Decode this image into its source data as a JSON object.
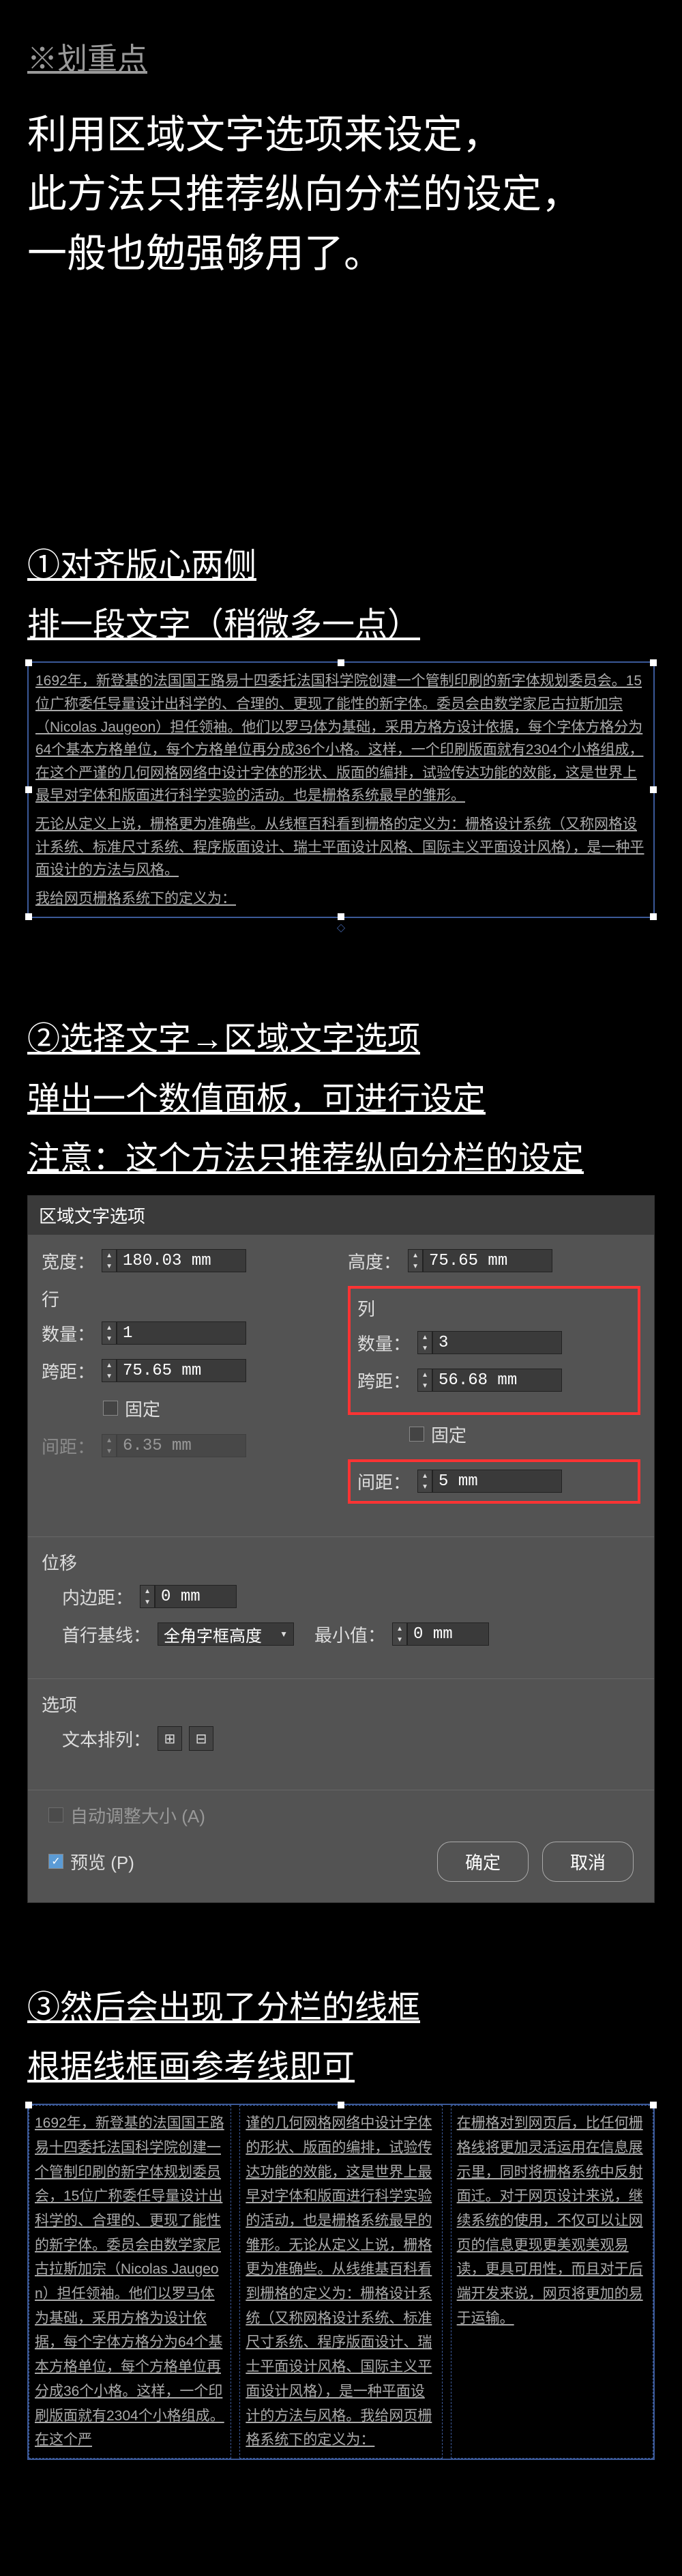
{
  "header": {
    "highlight": "※划重点"
  },
  "intro": "利用区域文字选项来设定，\n此方法只推荐纵向分栏的设定，\n一般也勉强够用了。",
  "section1": {
    "title1": "①对齐版心两侧",
    "title2": "排一段文字（稍微多一点）",
    "p1": "1692年，新登基的法国国王路易十四委托法国科学院创建一个管制印刷的新字体规划委员会。15位广称委任导量设计出科学的、合理的、更现了能性的新字体。委员会由数学家尼古拉斯加宗（Nicolas Jaugeon）担任领袖。他们以罗马体为基础，采用方格方设计依据，每个字体方格分为64个基本方格单位，每个方格单位再分成36个小格。这样，一个印刷版面就有2304个小格组成，在这个严谨的几何网格网络中设计字体的形状、版面的编排，试验传达功能的效能，这是世界上最早对字体和版面进行科学实验的活动。也是栅格系统最早的雏形。",
    "p2": "无论从定义上说，栅格更为准确些。从线框百科看到栅格的定义为：栅格设计系统（又称网格设计系统、标准尺寸系统、程序版面设计、瑞士平面设计风格、国际主义平面设计风格），是一种平面设计的方法与风格。",
    "p3": "我给网页栅格系统下的定义为："
  },
  "section2": {
    "title1": "②选择文字→区域文字选项",
    "title2": "弹出一个数值面板，可进行设定",
    "title3": "注意：这个方法只推荐纵向分栏的设定"
  },
  "dialog": {
    "title": "区域文字选项",
    "width_label": "宽度：",
    "width_value": "180.03 mm",
    "height_label": "高度：",
    "height_value": "75.65 mm",
    "rows_section": "行",
    "cols_section": "列",
    "count_label": "数量：",
    "row_count": "1",
    "col_count": "3",
    "span_label": "跨距：",
    "row_span": "75.65 mm",
    "col_span": "56.68 mm",
    "fixed_label": "固定",
    "gutter_label": "间距：",
    "row_gutter": "6.35 mm",
    "col_gutter": "5 mm",
    "offset_section": "位移",
    "inset_label": "内边距：",
    "inset_value": "0 mm",
    "baseline_label": "首行基线：",
    "baseline_value": "全角字框高度",
    "min_label": "最小值：",
    "min_value": "0 mm",
    "options_section": "选项",
    "text_flow_label": "文本排列：",
    "auto_resize": "自动调整大小 (A)",
    "preview_label": "预览 (P)",
    "ok": "确定",
    "cancel": "取消"
  },
  "section3": {
    "title1": "③然后会出现了分栏的线框",
    "title2": "根据线框画参考线即可",
    "col1": "1692年，新登基的法国国王路易十四委托法国科学院创建一个管制印刷的新字体规划委员会，15位广称委任导量设计出科学的、合理的、更现了能性的新字体。委员会由数学家尼古拉斯加宗（Nicolas Jaugeon）担任领袖。他们以罗马体为基础，采用方格为设计依据，每个字体方格分为64个基本方格单位，每个方格单位再分成36个小格。这样，一个印刷版面就有2304个小格组成。在这个严",
    "col2": "谨的几何网格网络中设计字体的形状、版面的编排，试验传达功能的效能，这是世界上最早对字体和版面进行科学实验的活动，也是栅格系统最早的雏形。无论从定义上说，栅格更为准确些。从线维基百科看到栅格的定义为：栅格设计系统（又称网格设计系统、标准尺寸系统、程序版面设计、瑞士平面设计风格、国际主义平面设计风格），是一种平面设计的方法与风格。我给网页栅格系统下的定义为：",
    "col3": "在栅格对到网页后，比任何栅格线将更加灵活运用在信息展示里，同时将栅格系统中反射面迁。对于网页设计来说，继续系统的使用，不仅可以让网页的信息更现更美观美观易读，更具可用性，而且对于后端开发来说，网页将更加的易于运输。"
  }
}
